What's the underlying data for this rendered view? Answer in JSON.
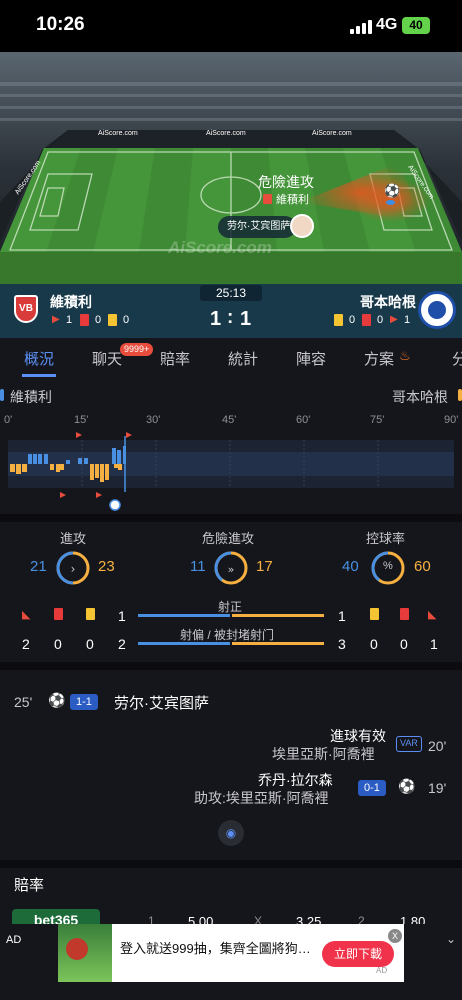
{
  "status_bar": {
    "time": "10:26",
    "network": "4G",
    "battery": "40"
  },
  "pitch": {
    "watermark": "AiScore.com",
    "ad_boards": [
      "AiScore.com",
      "AiScore.com",
      "AiScore.com",
      "AiScore.com",
      "AiScore.com"
    ],
    "event_title": "危險進攻",
    "event_team": "維積利",
    "player_tag": "劳尔·艾宾图萨"
  },
  "scoreboard": {
    "clock": "25:13",
    "home": {
      "name": "維積利",
      "logo_text": "VB",
      "corners": "1",
      "reds": "0",
      "yellows": "0"
    },
    "away": {
      "name": "哥本哈根",
      "corners": "1",
      "reds": "0",
      "yellows": "0"
    },
    "home_score": "1",
    "separator": ":",
    "away_score": "1"
  },
  "tabs": [
    {
      "label": "概況"
    },
    {
      "label": "聊天",
      "badge": "9999+"
    },
    {
      "label": "賠率"
    },
    {
      "label": "統計"
    },
    {
      "label": "陣容"
    },
    {
      "label": "方案"
    },
    {
      "label": "分"
    }
  ],
  "teams_row": {
    "home": "維積利",
    "away": "哥本哈根"
  },
  "timeline": {
    "ticks": [
      "0'",
      "15'",
      "30'",
      "45'",
      "60'",
      "75'",
      "90'"
    ],
    "colors": {
      "home": "#4a90e2",
      "away": "#f5b041"
    }
  },
  "stats": {
    "attacks": {
      "label": "進攻",
      "home": "21",
      "away": "23",
      "home_pct": 0.48
    },
    "dangerous": {
      "label": "危險進攻",
      "home": "11",
      "away": "17",
      "home_pct": 0.39
    },
    "possession": {
      "label": "控球率",
      "home": "40",
      "away": "60",
      "home_pct": 0.4,
      "icon": "%"
    },
    "shots_on": {
      "label": "射正",
      "home": "1",
      "away": "1"
    },
    "shots_off": {
      "label": "射偏 / 被封堵射门",
      "home": "2",
      "away": "3"
    },
    "home_counts": {
      "corners": "2",
      "reds": "0",
      "yellows": "0"
    },
    "away_counts": {
      "yellows": "0",
      "reds": "0",
      "corners": "1"
    }
  },
  "events": [
    {
      "minute": "25'",
      "score": "1-1",
      "player": "劳尔·艾宾图萨",
      "side": "home"
    },
    {
      "minute": "20'",
      "title": "進球有效",
      "player": "埃里亞斯·阿喬裡",
      "badge": "VAR",
      "side": "away"
    },
    {
      "minute": "19'",
      "score": "0-1",
      "player": "乔丹·拉尔森",
      "assist": "助攻:埃里亞斯·阿喬裡",
      "side": "away"
    }
  ],
  "odds": {
    "title": "賠率",
    "bookmaker": "bet365",
    "cells": [
      "1",
      "5.00",
      "X",
      "3.25",
      "2",
      "1.80"
    ]
  },
  "ad": {
    "label": "AD",
    "text": "登入就送999抽，集齊全圖將狗…",
    "button": "立即下載",
    "close": "X",
    "footer": "AD"
  }
}
